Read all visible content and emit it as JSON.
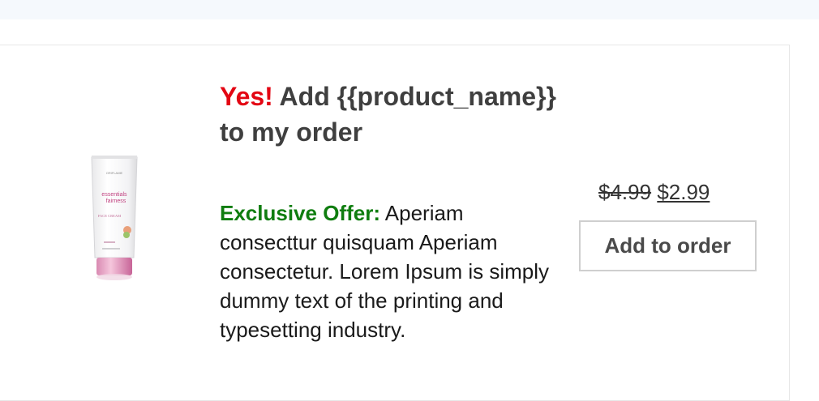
{
  "offer": {
    "headline_highlight": "Yes!",
    "headline_rest": " Add {{product_name}} to my order",
    "offer_label": "Exclusive Offer:",
    "description": " Aperiam consecttur quisquam Aperiam consectetur. Lorem Ipsum is simply dummy text of the printing and typesetting industry.",
    "old_price": "$4.99",
    "new_price": "$2.99",
    "button_label": "Add to order"
  },
  "product_image": {
    "brand": "ORIFLAME",
    "line1": "essentials",
    "line2": "fairness",
    "type": "FACE CREAM"
  },
  "colors": {
    "highlight": "#e30613",
    "offer": "#0f7d0f",
    "tube_pink": "#c0407f"
  }
}
